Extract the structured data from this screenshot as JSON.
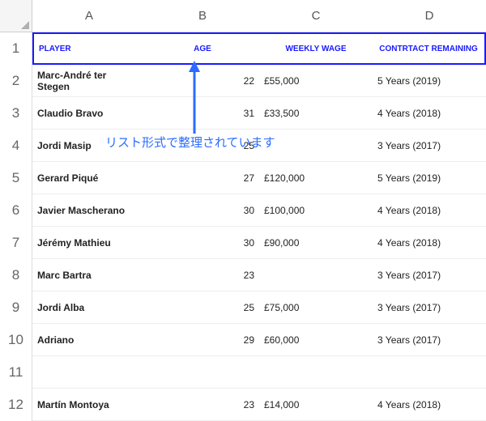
{
  "columns": [
    "A",
    "B",
    "C",
    "D"
  ],
  "row_numbers": [
    1,
    2,
    3,
    4,
    5,
    6,
    7,
    8,
    9,
    10,
    11,
    12
  ],
  "header": {
    "player": "PLAYER",
    "age": "AGE",
    "wage": "WEEKLY WAGE",
    "contract": "CONTRTACT REMAINING"
  },
  "rows": [
    {
      "player": "Marc-André ter Stegen",
      "age": "22",
      "wage": "£55,000",
      "contract": "5 Years (2019)"
    },
    {
      "player": "Claudio Bravo",
      "age": "31",
      "wage": "£33,500",
      "contract": "4 Years (2018)"
    },
    {
      "player": "Jordi Masip",
      "age": "25",
      "wage": "",
      "contract": "3 Years (2017)"
    },
    {
      "player": "Gerard Piqué",
      "age": "27",
      "wage": "£120,000",
      "contract": "5 Years (2019)"
    },
    {
      "player": "Javier Mascherano",
      "age": "30",
      "wage": "£100,000",
      "contract": "4 Years (2018)"
    },
    {
      "player": "Jérémy Mathieu",
      "age": "30",
      "wage": "£90,000",
      "contract": "4 Years (2018)"
    },
    {
      "player": "Marc Bartra",
      "age": "23",
      "wage": "",
      "contract": "3 Years (2017)"
    },
    {
      "player": "Jordi Alba",
      "age": "25",
      "wage": "£75,000",
      "contract": "3 Years (2017)"
    },
    {
      "player": "Adriano",
      "age": "29",
      "wage": "£60,000",
      "contract": "3 Years (2017)"
    },
    {
      "player": "",
      "age": "",
      "wage": "",
      "contract": ""
    },
    {
      "player": "Martín Montoya",
      "age": "23",
      "wage": "£14,000",
      "contract": "4 Years (2018)"
    }
  ],
  "annotation": "リスト形式で整理されています",
  "chart_data": {
    "type": "table",
    "title": "",
    "columns": [
      "PLAYER",
      "AGE",
      "WEEKLY WAGE",
      "CONTRTACT REMAINING"
    ],
    "rows": [
      [
        "Marc-André ter Stegen",
        22,
        "£55,000",
        "5 Years (2019)"
      ],
      [
        "Claudio Bravo",
        31,
        "£33,500",
        "4 Years (2018)"
      ],
      [
        "Jordi Masip",
        25,
        "",
        "3 Years (2017)"
      ],
      [
        "Gerard Piqué",
        27,
        "£120,000",
        "5 Years (2019)"
      ],
      [
        "Javier Mascherano",
        30,
        "£100,000",
        "4 Years (2018)"
      ],
      [
        "Jérémy Mathieu",
        30,
        "£90,000",
        "4 Years (2018)"
      ],
      [
        "Marc Bartra",
        23,
        "",
        "3 Years (2017)"
      ],
      [
        "Jordi Alba",
        25,
        "£75,000",
        "3 Years (2017)"
      ],
      [
        "Adriano",
        29,
        "£60,000",
        "3 Years (2017)"
      ],
      [
        "",
        "",
        "",
        ""
      ],
      [
        "Martín Montoya",
        23,
        "£14,000",
        "4 Years (2018)"
      ]
    ]
  }
}
